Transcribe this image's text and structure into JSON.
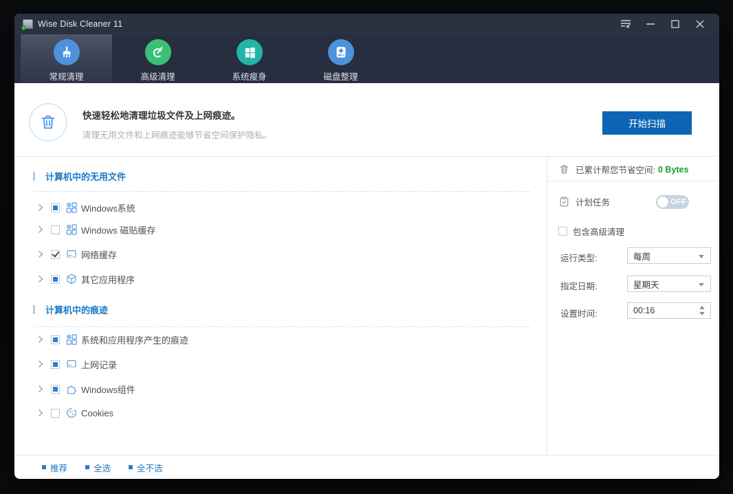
{
  "window": {
    "title": "Wise Disk Cleaner 11"
  },
  "tabs": [
    {
      "label": "常规清理",
      "active": true,
      "icon": "broom-icon",
      "color": "#4e92dd"
    },
    {
      "label": "高级清理",
      "active": false,
      "icon": "gauge-icon",
      "color": "#3bbf74"
    },
    {
      "label": "系统瘦身",
      "active": false,
      "icon": "windows-icon",
      "color": "#23b4a9"
    },
    {
      "label": "磁盘整理",
      "active": false,
      "icon": "disk-icon",
      "color": "#4e92dd"
    }
  ],
  "header": {
    "title": "快速轻松地清理垃圾文件及上网痕迹。",
    "subtitle": "清理无用文件和上网痕迹能够节省空间保护隐私。",
    "scan_button": "开始扫描"
  },
  "left_panel": {
    "sections": [
      {
        "heading": "计算机中的无用文件",
        "items": [
          {
            "label": "Windows系统",
            "checkbox": "indeterminate",
            "icon": "windows-tiles-icon"
          },
          {
            "label": "Windows 磁贴缓存",
            "checkbox": "unchecked",
            "icon": "windows-tiles-icon"
          },
          {
            "label": "网络缓存",
            "checkbox": "checked",
            "icon": "browser-cache-icon"
          },
          {
            "label": "其它应用程序",
            "checkbox": "indeterminate",
            "icon": "cube-icon"
          }
        ]
      },
      {
        "heading": "计算机中的痕迹",
        "items": [
          {
            "label": "系统和应用程序产生的痕迹",
            "checkbox": "indeterminate",
            "icon": "windows-tiles-icon"
          },
          {
            "label": "上网记录",
            "checkbox": "indeterminate",
            "icon": "browser-cache-icon"
          },
          {
            "label": "Windows组件",
            "checkbox": "indeterminate",
            "icon": "puzzle-icon"
          },
          {
            "label": "Cookies",
            "checkbox": "unchecked",
            "icon": "cookie-icon"
          }
        ]
      }
    ]
  },
  "right_panel": {
    "saved_label": "已累计帮您节省空间:",
    "saved_value": "0 Bytes",
    "schedule_label": "计划任务",
    "schedule_toggle": "OFF",
    "advanced_label": "包含高级清理",
    "fields": [
      {
        "label": "运行类型:",
        "value": "每周",
        "type": "select"
      },
      {
        "label": "指定日期:",
        "value": "星期天",
        "type": "select"
      },
      {
        "label": "设置时间:",
        "value": "00:16",
        "type": "spinner"
      }
    ]
  },
  "footer": {
    "links": [
      {
        "label": "推荐"
      },
      {
        "label": "全选"
      },
      {
        "label": "全不选"
      }
    ]
  },
  "colors": {
    "titlebar": "#2a3140",
    "tab_bar": "#272e3f",
    "accent_blue": "#0d65b5",
    "link_blue": "#2478c2",
    "saved_green": "#189e2c",
    "heading_blue": "#1b79c7",
    "tab_icon_blue": "#4e92dd",
    "tab_icon_green": "#3bbf74",
    "tab_icon_teal": "#23b4a9"
  }
}
